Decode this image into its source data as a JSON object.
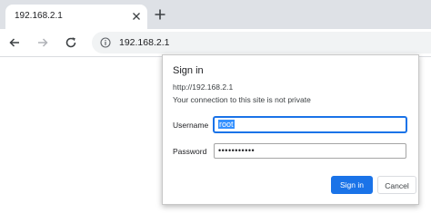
{
  "tab": {
    "title": "192.168.2.1",
    "close_icon": "close-icon"
  },
  "new_tab_icon": "plus-icon",
  "toolbar": {
    "back_icon": "arrow-left-icon",
    "forward_icon": "arrow-right-icon",
    "reload_icon": "reload-icon",
    "info_icon": "info-icon",
    "url": "192.168.2.1"
  },
  "dialog": {
    "title": "Sign in",
    "host": "http://192.168.2.1",
    "warning": "Your connection to this site is not private",
    "username_label": "Username",
    "username_value": "root",
    "password_label": "Password",
    "password_masked": "•••••••••••",
    "sign_in_label": "Sign in",
    "cancel_label": "Cancel"
  },
  "colors": {
    "accent": "#1a73e8",
    "tabstrip": "#dee1e6",
    "omnibox": "#f1f3f4"
  }
}
